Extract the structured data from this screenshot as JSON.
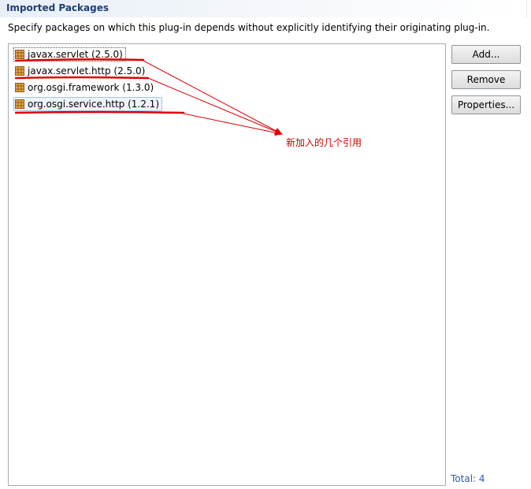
{
  "section": {
    "title": "Imported Packages",
    "description": "Specify packages on which this plug-in depends without explicitly identifying their originating plug-in."
  },
  "packages": [
    {
      "label": "javax.servlet (2.5.0)",
      "icon": "package-icon",
      "state": "focused"
    },
    {
      "label": "javax.servlet.http (2.5.0)",
      "icon": "package-icon",
      "state": "normal"
    },
    {
      "label": "org.osgi.framework (1.3.0)",
      "icon": "package-icon",
      "state": "normal"
    },
    {
      "label": "org.osgi.service.http (1.2.1)",
      "icon": "package-icon",
      "state": "selected"
    }
  ],
  "buttons": {
    "add": "Add...",
    "remove": "Remove",
    "properties": "Properties..."
  },
  "total_label": "Total: 4",
  "annotation": {
    "text": "新加入的几个引用",
    "color": "#cc0000"
  },
  "colors": {
    "title": "#1f3f74",
    "total": "#2a5db0",
    "selection_border": "#a7c3e6"
  }
}
